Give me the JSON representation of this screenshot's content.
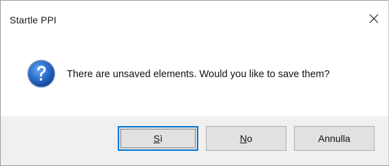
{
  "window": {
    "title": "Startle PPI",
    "close_icon": "close-icon"
  },
  "message": {
    "icon": "question-icon",
    "text": "There are unsaved elements. Would you like to save them?"
  },
  "buttons": {
    "yes": {
      "mnemonic": "S",
      "rest": "ì"
    },
    "no": {
      "mnemonic": "N",
      "rest": "o"
    },
    "cancel": {
      "label": "Annulla"
    }
  },
  "colors": {
    "footer_bg": "#f0f0f0",
    "default_button_border": "#0078d7",
    "icon_blue": "#1f5fbf"
  }
}
